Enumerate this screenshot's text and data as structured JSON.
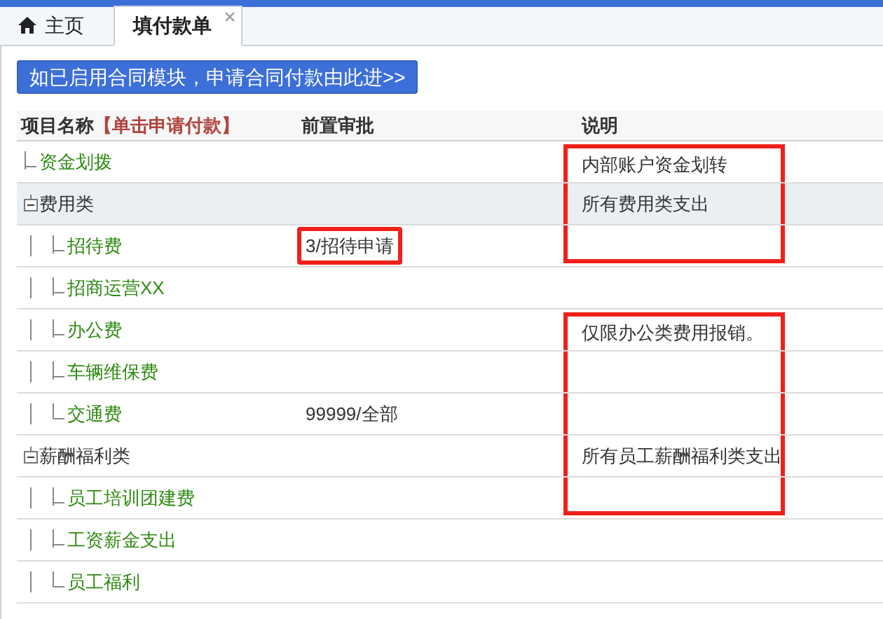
{
  "tabs": [
    {
      "label": "主页",
      "kind": "home",
      "selected": false,
      "closable": false
    },
    {
      "label": "填付款单",
      "kind": "page",
      "selected": true,
      "closable": true
    }
  ],
  "contract_button": "如已启用合同模块，申请合同付款由此进>>",
  "table": {
    "columns": [
      {
        "label": "项目名称",
        "hint": "【单击申请付款】"
      },
      {
        "label": "前置审批"
      },
      {
        "label": "说明"
      }
    ],
    "rows": [
      {
        "name": "资金划拨",
        "kind": "item",
        "selected": false,
        "note": "内部账户资金划转",
        "note_framed": true
      },
      {
        "name": "费用类",
        "kind": "group",
        "expanded": true,
        "selected": true,
        "note": "所有费用类支出",
        "note_framed": true,
        "children": [
          {
            "name": "招待费",
            "kind": "item",
            "selected": false,
            "approval": {
              "text": "3/招待申请",
              "framed": true
            },
            "note_framed": true
          },
          {
            "name": "招商运营XX",
            "kind": "item",
            "selected": false,
            "note_framed": false
          },
          {
            "name": "办公费",
            "kind": "item",
            "selected": false,
            "note": "仅限办公类费用报销。",
            "note_framed": true
          },
          {
            "name": "车辆维保费",
            "kind": "item",
            "selected": false,
            "note_framed": true
          },
          {
            "name": "交通费",
            "kind": "item",
            "selected": false,
            "approval": {
              "text": "99999/全部",
              "framed": false
            },
            "note_framed": true
          }
        ]
      },
      {
        "name": "薪酬福利类",
        "kind": "group",
        "expanded": true,
        "selected": false,
        "note": "所有员工薪酬福利类支出",
        "note_framed": true,
        "children": [
          {
            "name": "员工培训团建费",
            "kind": "item",
            "selected": false,
            "note_framed": true
          },
          {
            "name": "工资薪金支出",
            "kind": "item",
            "selected": false,
            "note_framed": false
          },
          {
            "name": "员工福利",
            "kind": "item",
            "selected": false,
            "note_framed": false
          }
        ]
      }
    ]
  }
}
